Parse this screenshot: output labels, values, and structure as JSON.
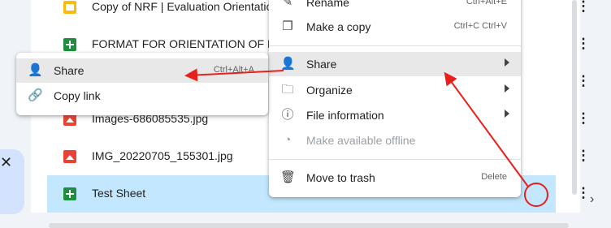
{
  "files": [
    {
      "name": "Copy of NRF | Evaluation Orientation",
      "type": "slides"
    },
    {
      "name": "FORMAT FOR ORIENTATION OF PR",
      "type": "sheets"
    },
    {
      "name": "Images-686085535.jpg",
      "type": "image"
    },
    {
      "name": "IMG_20220705_155301.jpg",
      "type": "image"
    },
    {
      "name": "Test Sheet",
      "type": "sheets",
      "selected": true
    }
  ],
  "context_menu": {
    "items": [
      {
        "label": "Rename",
        "shortcut": "Ctrl+Alt+E",
        "icon": "pencil-icon"
      },
      {
        "label": "Make a copy",
        "shortcut": "Ctrl+C Ctrl+V",
        "icon": "copy-icon"
      },
      {
        "label": "Share",
        "icon": "person-add-icon",
        "submenu": true,
        "highlighted": true
      },
      {
        "label": "Organize",
        "icon": "folder-icon",
        "submenu": true
      },
      {
        "label": "File information",
        "icon": "info-icon",
        "submenu": true
      },
      {
        "label": "Make available offline",
        "icon": "offline-check-icon",
        "disabled": true
      },
      {
        "label": "Move to trash",
        "shortcut": "Delete",
        "icon": "trash-icon"
      }
    ]
  },
  "share_submenu": {
    "items": [
      {
        "label": "Share",
        "shortcut": "Ctrl+Alt+A",
        "icon": "person-add-icon",
        "highlighted": true
      },
      {
        "label": "Copy link",
        "icon": "link-icon"
      }
    ]
  },
  "icons": {
    "more": "more-vert-icon",
    "close": "close-icon",
    "next": "chevron-right-icon"
  },
  "glyphs": {
    "kebab": "⋮",
    "close": "✕",
    "next": "›"
  },
  "colors": {
    "selection": "#c2e7ff",
    "highlight": "#e8e8e8",
    "annotation": "#e8201c",
    "sheets": "#1e8e3e",
    "slides": "#f9bb0d",
    "image": "#ea4335"
  }
}
